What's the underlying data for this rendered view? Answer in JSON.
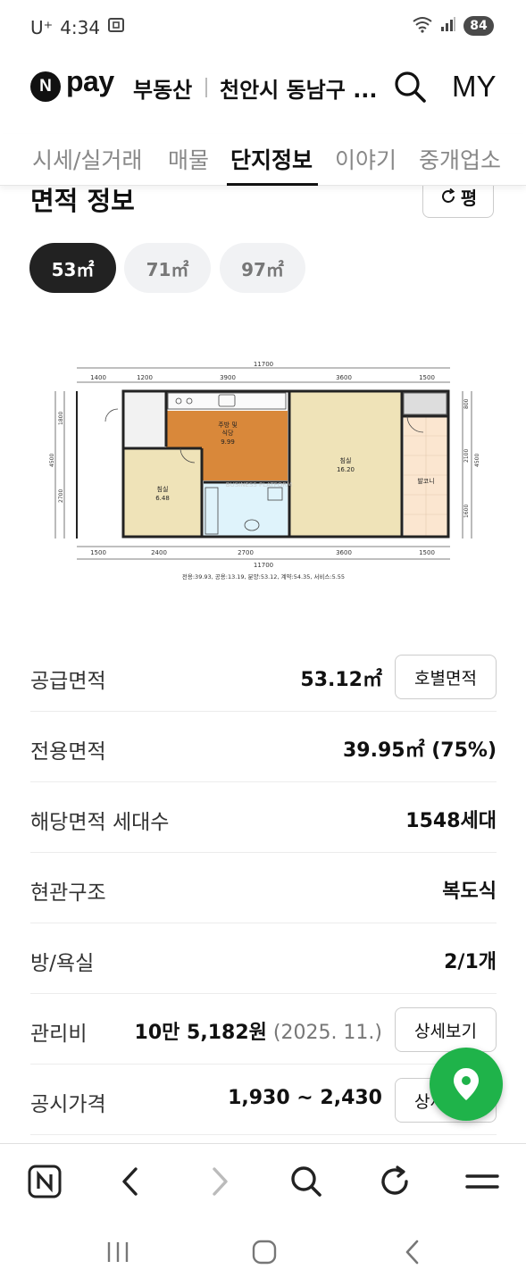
{
  "status_bar": {
    "carrier": "U⁺",
    "time": "4:34",
    "battery": "84"
  },
  "header": {
    "logo_letter": "N",
    "pay_text": "pay",
    "service_name": "부동산",
    "region_title": "천안시 동남구 ...",
    "my_label": "MY"
  },
  "tabs": [
    {
      "label": "시세/실거래",
      "active": false
    },
    {
      "label": "매물",
      "active": false
    },
    {
      "label": "단지정보",
      "active": true
    },
    {
      "label": "이야기",
      "active": false
    },
    {
      "label": "중개업소",
      "active": false
    }
  ],
  "section": {
    "title": "면적 정보",
    "unit_toggle_label": "평"
  },
  "area_options": [
    {
      "label": "53㎡",
      "selected": true
    },
    {
      "label": "71㎡",
      "selected": false
    },
    {
      "label": "97㎡",
      "selected": false
    }
  ],
  "floorplan": {
    "dims_top": [
      "1400",
      "1200",
      "3900",
      "3600",
      "1500"
    ],
    "dims_bottom": [
      "1500",
      "2400",
      "2700",
      "3600",
      "1500"
    ],
    "total_width": "11700",
    "left_dims": [
      "1800",
      "2700"
    ],
    "left_total": "4500",
    "right_dims": [
      "800",
      "2100",
      "1600"
    ],
    "right_total": "4500",
    "rooms": [
      {
        "name": "주방 및",
        "name2": "식당",
        "area": "9.99"
      },
      {
        "name": "침실",
        "area": "6.48"
      },
      {
        "name": "침실",
        "area": "16.20"
      },
      {
        "name": "발코니",
        "area": ""
      }
    ],
    "watermark": "BUSINESS PLATFORM",
    "summary": "전용:39.93, 공용:13.19, 분양:53.12, 계약:54.35, 서비스:5.55"
  },
  "info_rows": [
    {
      "label": "공급면적",
      "value": "53.12㎡",
      "sub": "",
      "button": "호별면적"
    },
    {
      "label": "전용면적",
      "value": "39.95㎡ (75%)",
      "sub": "",
      "button": ""
    },
    {
      "label": "해당면적 세대수",
      "value": "1548세대",
      "sub": "",
      "button": ""
    },
    {
      "label": "현관구조",
      "value": "복도식",
      "sub": "",
      "button": ""
    },
    {
      "label": "방/욕실",
      "value": "2/1개",
      "sub": "",
      "button": ""
    },
    {
      "label": "관리비",
      "value": "10만 5,182원",
      "sub": " (2025. 11.)",
      "button": "상세보기"
    },
    {
      "label": "공시가격",
      "value": "1,930 ~ 2,430",
      "sub": "",
      "button": "상세보기"
    }
  ],
  "colors": {
    "accent_green": "#1fb34a",
    "pill_active": "#222222",
    "kitchen_floor": "#d9883a",
    "room_floor": "#efe3b8"
  }
}
